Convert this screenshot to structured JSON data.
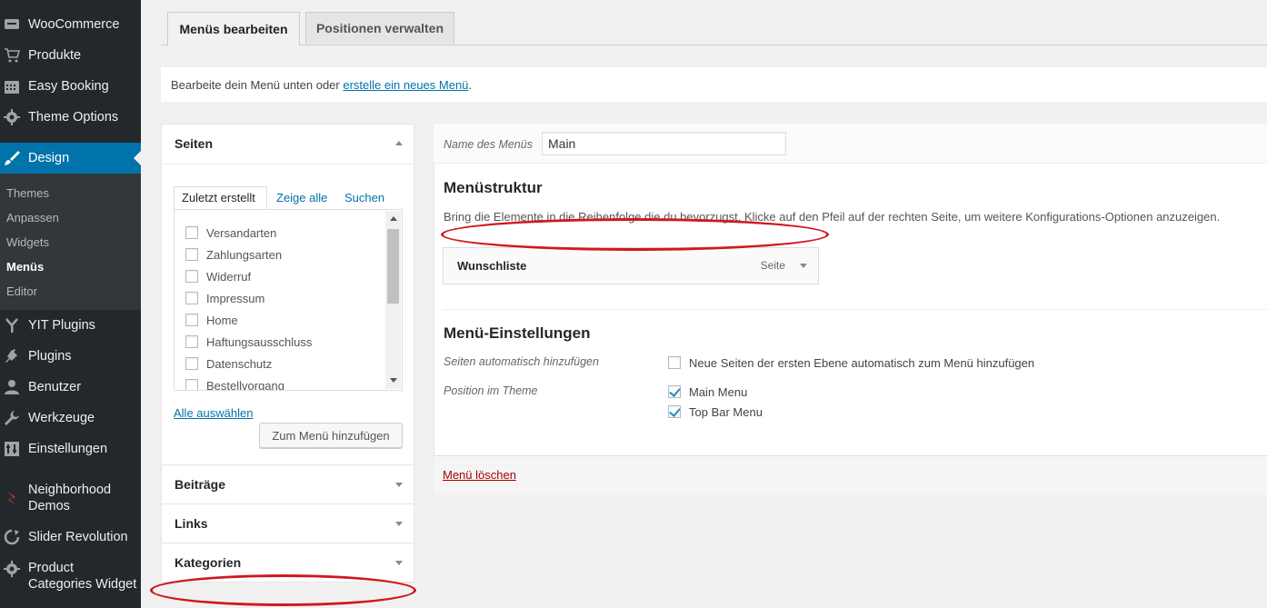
{
  "sidebar": {
    "items": [
      {
        "label": "WooCommerce",
        "icon": "woocommerce-icon"
      },
      {
        "label": "Produkte",
        "icon": "cart-icon"
      },
      {
        "label": "Easy Booking",
        "icon": "calendar-icon"
      },
      {
        "label": "Theme Options",
        "icon": "gear-icon"
      },
      {
        "label": "Design",
        "icon": "brush-icon"
      },
      {
        "label": "YIT Plugins",
        "icon": "yit-icon"
      },
      {
        "label": "Plugins",
        "icon": "plugin-icon"
      },
      {
        "label": "Benutzer",
        "icon": "user-icon"
      },
      {
        "label": "Werkzeuge",
        "icon": "wrench-icon"
      },
      {
        "label": "Einstellungen",
        "icon": "settings-icon"
      },
      {
        "label": "Neighborhood Demos",
        "icon": "neighborhood-icon"
      },
      {
        "label": "Slider Revolution",
        "icon": "refresh-icon"
      },
      {
        "label": "Product Categories Widget",
        "icon": "gear-icon"
      }
    ],
    "submenu": [
      "Themes",
      "Anpassen",
      "Widgets",
      "Menüs",
      "Editor"
    ],
    "active_submenu": "Menüs"
  },
  "tabs": {
    "edit": "Menüs bearbeiten",
    "locations": "Positionen verwalten"
  },
  "notice": {
    "text": "Bearbeite dein Menü unten oder ",
    "link": "erstelle ein neues Menü",
    "end": "."
  },
  "pages_panel": {
    "title": "Seiten",
    "tabs": [
      "Zuletzt erstellt",
      "Zeige alle",
      "Suchen"
    ],
    "items": [
      "Versandarten",
      "Zahlungsarten",
      "Widerruf",
      "Impressum",
      "Home",
      "Haftungsausschluss",
      "Datenschutz",
      "Bestellvorgang"
    ],
    "select_all": "Alle auswählen",
    "add_button": "Zum Menü hinzufügen"
  },
  "other_panels": [
    "Beiträge",
    "Links",
    "Kategorien"
  ],
  "menu_editor": {
    "name_label": "Name des Menüs",
    "name_value": "Main",
    "structure_title": "Menüstruktur",
    "structure_desc": "Bring die Elemente in die Reihenfolge die du bevorzugst. Klicke auf den Pfeil auf der rechten Seite, um weitere Konfigurations-Optionen anzuzeigen.",
    "item_title": "Wunschliste",
    "item_type": "Seite",
    "settings_title": "Menü-Einstellungen",
    "auto_add_label": "Seiten automatisch hinzufügen",
    "auto_add_option": "Neue Seiten der ersten Ebene automatisch zum Menü hinzufügen",
    "auto_add_checked": false,
    "theme_position_label": "Position im Theme",
    "locations": [
      {
        "label": "Main Menu",
        "checked": true
      },
      {
        "label": "Top Bar Menu",
        "checked": true
      }
    ],
    "delete_link": "Menü löschen"
  },
  "colors": {
    "sidebar_bg": "#23282d",
    "accent": "#0073aa",
    "annotation_red": "#d0181f"
  }
}
